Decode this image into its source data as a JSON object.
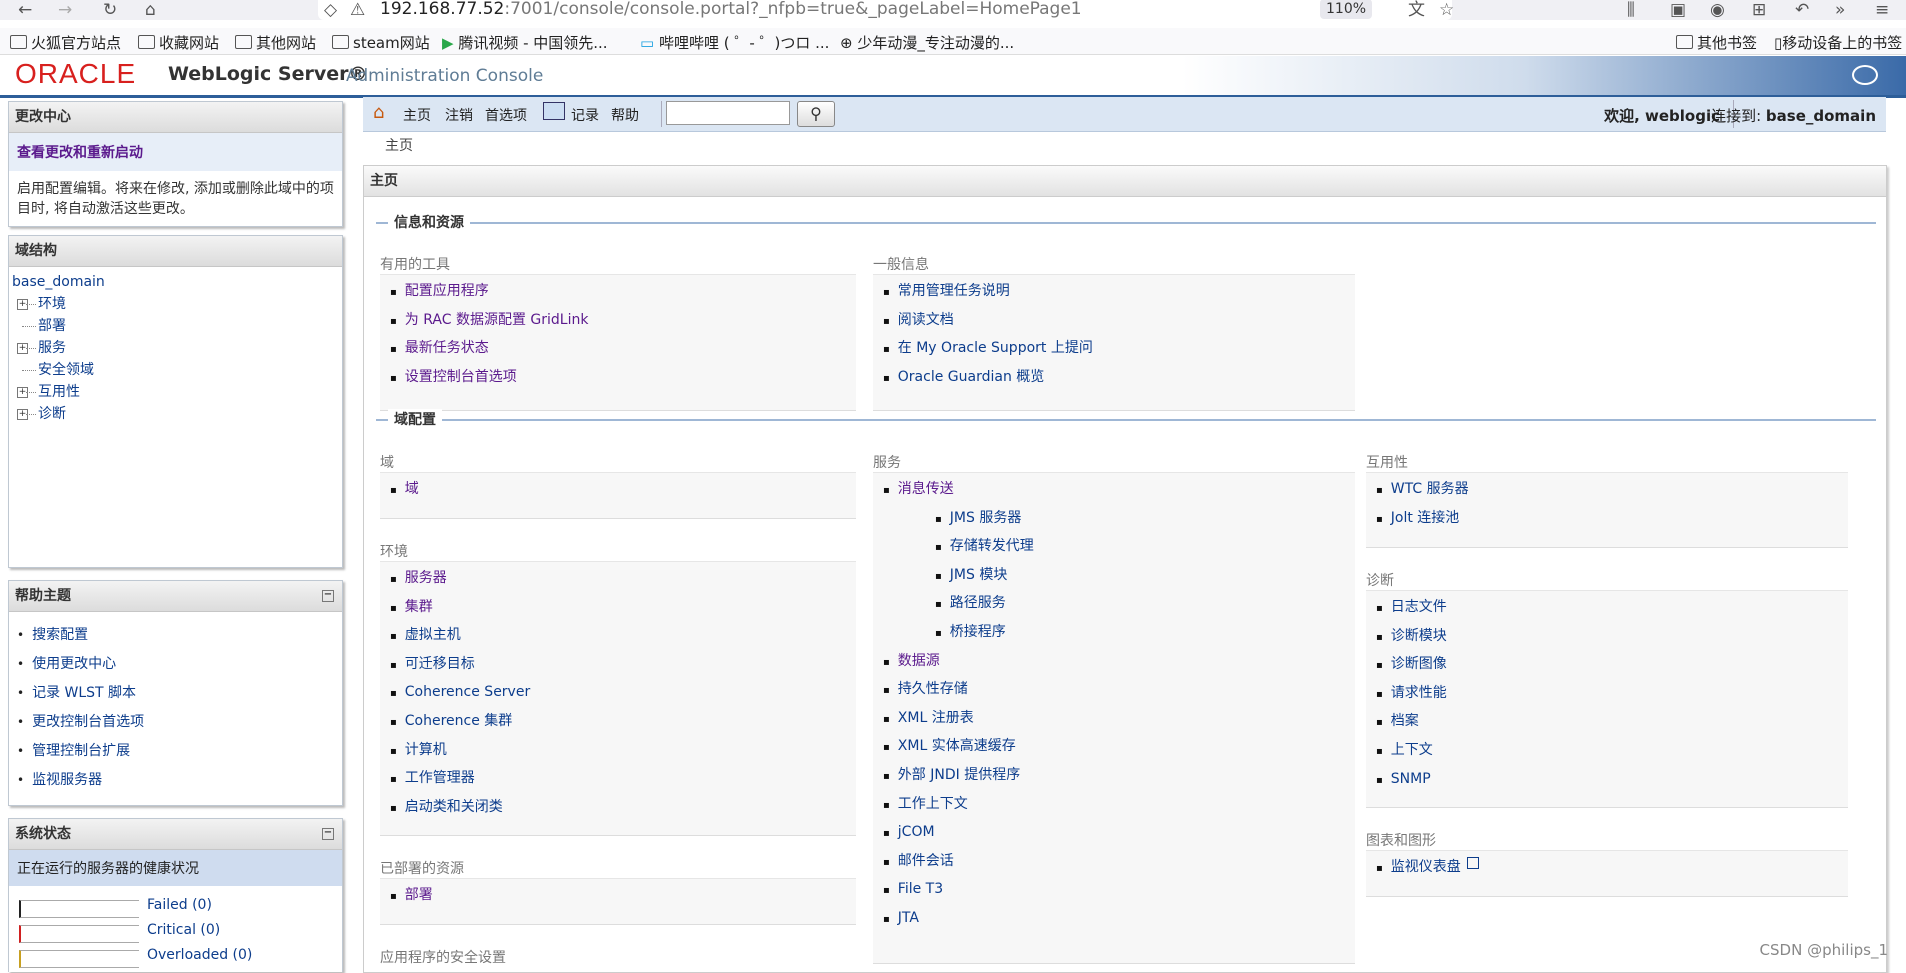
{
  "browser": {
    "url_host": "192.168.77.52",
    "url_rest": ":7001/console/console.portal?_nfpb=true&_pageLabel=HomePage1",
    "zoom": "110%",
    "bookmarks_left": [
      "火狐官方站点",
      "收藏网站",
      "其他网站",
      "steam网站",
      "腾讯视频 - 中国领先...",
      "哔哩哔哩 ( ゜- ゜)つロ ...",
      "少年动漫_专注动漫的..."
    ],
    "bookmarks_right": [
      "其他书签",
      "移动设备上的书签"
    ]
  },
  "header": {
    "oracle": "ORACLE",
    "product": "WebLogic Server®",
    "subtitle": "Administration Console"
  },
  "change_center": {
    "title": "更改中心",
    "link": "查看更改和重新启动",
    "text": "启用配置编辑。将来在修改, 添加或删除此域中的项目时, 将自动激活这些更改。"
  },
  "domain_structure": {
    "title": "域结构",
    "root": "base_domain",
    "items": [
      {
        "label": "环境",
        "expandable": true
      },
      {
        "label": "部署",
        "expandable": false
      },
      {
        "label": "服务",
        "expandable": true
      },
      {
        "label": "安全领域",
        "expandable": false
      },
      {
        "label": "互用性",
        "expandable": true
      },
      {
        "label": "诊断",
        "expandable": true
      }
    ]
  },
  "help_topics": {
    "title": "帮助主题",
    "items": [
      "搜索配置",
      "使用更改中心",
      "记录 WLST 脚本",
      "更改控制台首选项",
      "管理控制台扩展",
      "监视服务器"
    ]
  },
  "system_status": {
    "title": "系统状态",
    "subtitle": "正在运行的服务器的健康状况",
    "rows": [
      {
        "label": "Failed (0)",
        "color": "#222222"
      },
      {
        "label": "Critical (0)",
        "color": "#d02020"
      },
      {
        "label": "Overloaded (0)",
        "color": "#c8a020"
      }
    ]
  },
  "nav": {
    "home": "主页",
    "logout": "注销",
    "prefs": "首选项",
    "record": "记录",
    "help": "帮助",
    "welcome": "欢迎, weblogic",
    "connected_label": "连接到:",
    "connected_domain": "base_domain"
  },
  "breadcrumb": "主页",
  "main": {
    "title": "主页",
    "section_info": "信息和资源",
    "useful_tools_title": "有用的工具",
    "useful_tools": [
      "配置应用程序",
      "为 RAC 数据源配置 GridLink",
      "最新任务状态",
      "设置控制台首选项"
    ],
    "general_info_title": "一般信息",
    "general_info": [
      "常用管理任务说明",
      "阅读文档",
      "在 My Oracle Support 上提问",
      "Oracle Guardian 概览"
    ],
    "section_domain": "域配置",
    "domain_title": "域",
    "domain_items": [
      "域"
    ],
    "env_title": "环境",
    "env_items": [
      "服务器",
      "集群",
      "虚拟主机",
      "可迁移目标",
      "Coherence Server",
      "Coherence 集群",
      "计算机",
      "工作管理器",
      "启动类和关闭类"
    ],
    "deployed_title": "已部署的资源",
    "deployed_items": [
      "部署"
    ],
    "security_title": "应用程序的安全设置",
    "services_title": "服务",
    "services_messaging": "消息传送",
    "services_messaging_sub": [
      "JMS 服务器",
      "存储转发代理",
      "JMS 模块",
      "路径服务",
      "桥接程序"
    ],
    "services_items": [
      "数据源",
      "持久性存储",
      "XML 注册表",
      "XML 实体高速缓存",
      "外部 JNDI 提供程序",
      "工作上下文",
      "jCOM",
      "邮件会话",
      "File T3",
      "JTA"
    ],
    "interop_title": "互用性",
    "interop_items": [
      "WTC 服务器",
      "Jolt 连接池"
    ],
    "diag_title": "诊断",
    "diag_items": [
      "日志文件",
      "诊断模块",
      "诊断图像",
      "请求性能",
      "档案",
      "上下文",
      "SNMP"
    ],
    "charts_title": "图表和图形",
    "charts_items": [
      "监视仪表盘"
    ]
  },
  "watermark": "CSDN @philips_1"
}
